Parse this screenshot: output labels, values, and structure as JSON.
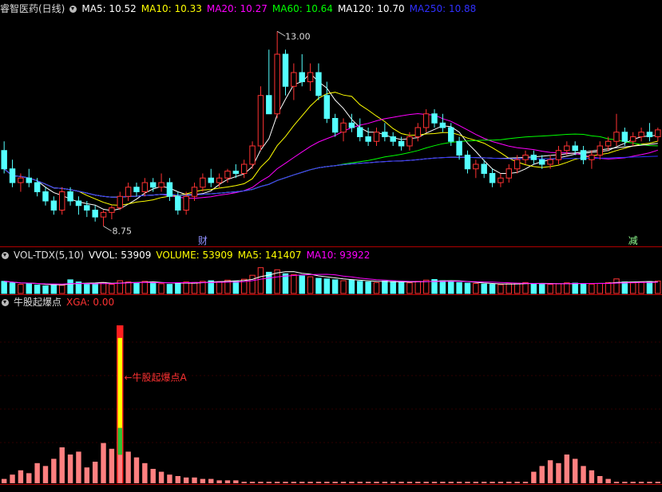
{
  "price_panel": {
    "stock_name": "睿智医药(日线)",
    "ma": [
      {
        "label": "MA5: 10.52",
        "color": "#ffffff"
      },
      {
        "label": "MA10: 10.33",
        "color": "#ffff00"
      },
      {
        "label": "MA20: 10.27",
        "color": "#ff00ff"
      },
      {
        "label": "MA60: 10.64",
        "color": "#00ff00"
      },
      {
        "label": "MA120: 10.70",
        "color": "#ffffff"
      },
      {
        "label": "MA250: 10.88",
        "color": "#3030ff"
      }
    ],
    "high_label": "13.00",
    "low_label": "8.75",
    "marker_left": "财",
    "marker_right": "减"
  },
  "volume_panel": {
    "name": "VOL-TDX(5,10)",
    "items": [
      {
        "label": "VVOL: 53909",
        "color": "#ffffff"
      },
      {
        "label": "VOLUME: 53909",
        "color": "#ffff00"
      },
      {
        "label": "MA5: 141407",
        "color": "#ffff00"
      },
      {
        "label": "MA10: 93922",
        "color": "#ff00ff"
      }
    ]
  },
  "indicator_panel": {
    "name": "牛股起爆点",
    "xga_label": "XGA: 0.00",
    "signal_label": "牛股起爆点A"
  },
  "colors": {
    "up": "#ff3232",
    "down": "#54ffff",
    "grid": "#b00000",
    "ma5": "#ffffff",
    "ma10": "#ffff00",
    "ma20": "#ff00ff",
    "ma60": "#00ff00",
    "ma120": "#ffffff",
    "ma250": "#3030ff",
    "indicator_bar": "#ff8080"
  },
  "chart_data": [
    {
      "type": "candlestick",
      "title": "睿智医药(日线)",
      "ylim": [
        8.5,
        13.3
      ],
      "ohlc": [
        [
          10.4,
          10.6,
          9.9,
          10.0
        ],
        [
          10.0,
          10.2,
          9.6,
          9.7
        ],
        [
          9.7,
          9.9,
          9.5,
          9.8
        ],
        [
          9.8,
          10.0,
          9.6,
          9.7
        ],
        [
          9.7,
          9.8,
          9.4,
          9.5
        ],
        [
          9.5,
          9.6,
          9.2,
          9.3
        ],
        [
          9.3,
          9.4,
          9.0,
          9.1
        ],
        [
          9.1,
          9.6,
          9.0,
          9.5
        ],
        [
          9.5,
          9.6,
          9.2,
          9.3
        ],
        [
          9.3,
          9.4,
          9.0,
          9.2
        ],
        [
          9.2,
          9.3,
          8.95,
          9.1
        ],
        [
          9.1,
          9.2,
          8.85,
          8.95
        ],
        [
          8.95,
          9.1,
          8.75,
          9.05
        ],
        [
          9.05,
          9.2,
          8.9,
          9.15
        ],
        [
          9.15,
          9.5,
          9.1,
          9.4
        ],
        [
          9.4,
          9.7,
          9.3,
          9.6
        ],
        [
          9.6,
          9.7,
          9.4,
          9.5
        ],
        [
          9.5,
          9.8,
          9.4,
          9.7
        ],
        [
          9.7,
          9.8,
          9.5,
          9.6
        ],
        [
          9.6,
          9.9,
          9.5,
          9.7
        ],
        [
          9.7,
          9.8,
          9.3,
          9.4
        ],
        [
          9.4,
          9.5,
          9.0,
          9.1
        ],
        [
          9.1,
          9.5,
          9.0,
          9.4
        ],
        [
          9.4,
          9.7,
          9.3,
          9.6
        ],
        [
          9.6,
          9.9,
          9.5,
          9.8
        ],
        [
          9.8,
          10.0,
          9.6,
          9.7
        ],
        [
          9.7,
          9.9,
          9.6,
          9.8
        ],
        [
          9.8,
          10.0,
          9.7,
          9.95
        ],
        [
          9.95,
          10.1,
          9.8,
          9.9
        ],
        [
          9.9,
          10.2,
          9.8,
          10.1
        ],
        [
          10.1,
          10.6,
          10.0,
          10.5
        ],
        [
          10.5,
          11.8,
          10.4,
          11.6
        ],
        [
          11.6,
          12.6,
          11.2,
          11.2
        ],
        [
          11.2,
          13.0,
          11.1,
          12.5
        ],
        [
          12.5,
          12.6,
          11.6,
          11.8
        ],
        [
          11.8,
          12.3,
          11.5,
          12.1
        ],
        [
          12.1,
          12.5,
          11.8,
          11.9
        ],
        [
          11.9,
          12.3,
          11.7,
          12.1
        ],
        [
          12.1,
          12.3,
          11.5,
          11.6
        ],
        [
          11.6,
          11.9,
          11.0,
          11.1
        ],
        [
          11.1,
          11.2,
          10.7,
          10.8
        ],
        [
          10.8,
          11.1,
          10.6,
          11.0
        ],
        [
          11.0,
          11.2,
          10.8,
          10.9
        ],
        [
          10.9,
          11.1,
          10.6,
          10.7
        ],
        [
          10.7,
          10.9,
          10.5,
          10.6
        ],
        [
          10.6,
          10.9,
          10.5,
          10.8
        ],
        [
          10.8,
          11.0,
          10.6,
          10.7
        ],
        [
          10.7,
          10.8,
          10.5,
          10.6
        ],
        [
          10.6,
          10.7,
          10.4,
          10.5
        ],
        [
          10.5,
          10.8,
          10.4,
          10.7
        ],
        [
          10.7,
          11.0,
          10.6,
          10.9
        ],
        [
          10.9,
          11.3,
          10.8,
          11.2
        ],
        [
          11.2,
          11.3,
          10.9,
          11.0
        ],
        [
          11.0,
          11.2,
          10.8,
          10.9
        ],
        [
          10.9,
          11.0,
          10.5,
          10.6
        ],
        [
          10.6,
          10.7,
          10.2,
          10.3
        ],
        [
          10.3,
          10.4,
          9.9,
          10.0
        ],
        [
          10.0,
          10.2,
          9.8,
          10.1
        ],
        [
          10.1,
          10.2,
          9.8,
          9.9
        ],
        [
          9.9,
          10.0,
          9.6,
          9.7
        ],
        [
          9.7,
          9.9,
          9.6,
          9.8
        ],
        [
          9.8,
          10.1,
          9.7,
          10.0
        ],
        [
          10.0,
          10.3,
          9.9,
          10.2
        ],
        [
          10.2,
          10.4,
          10.1,
          10.3
        ],
        [
          10.3,
          10.4,
          10.1,
          10.2
        ],
        [
          10.2,
          10.3,
          10.0,
          10.1
        ],
        [
          10.1,
          10.3,
          10.0,
          10.2
        ],
        [
          10.2,
          10.5,
          10.1,
          10.4
        ],
        [
          10.4,
          10.6,
          10.3,
          10.5
        ],
        [
          10.5,
          10.6,
          10.3,
          10.4
        ],
        [
          10.4,
          10.5,
          10.1,
          10.2
        ],
        [
          10.2,
          10.4,
          10.0,
          10.3
        ],
        [
          10.3,
          10.6,
          10.2,
          10.5
        ],
        [
          10.5,
          10.7,
          10.4,
          10.6
        ],
        [
          10.6,
          11.2,
          10.5,
          10.8
        ],
        [
          10.8,
          10.9,
          10.5,
          10.6
        ],
        [
          10.6,
          10.8,
          10.5,
          10.7
        ],
        [
          10.7,
          10.9,
          10.6,
          10.8
        ],
        [
          10.8,
          11.0,
          10.6,
          10.7
        ],
        [
          10.7,
          10.9,
          10.6,
          10.85
        ]
      ]
    },
    {
      "type": "bar",
      "title": "VOL-TDX(5,10)",
      "values": [
        40,
        35,
        30,
        32,
        28,
        25,
        30,
        27,
        45,
        38,
        30,
        33,
        36,
        30,
        42,
        38,
        35,
        40,
        37,
        32,
        30,
        34,
        38,
        36,
        40,
        42,
        39,
        44,
        41,
        47,
        60,
        85,
        70,
        78,
        65,
        62,
        58,
        55,
        50,
        48,
        45,
        42,
        44,
        40,
        38,
        36,
        41,
        39,
        37,
        35,
        40,
        44,
        46,
        42,
        39,
        36,
        34,
        33,
        31,
        30,
        29,
        32,
        34,
        36,
        33,
        31,
        30,
        32,
        35,
        34,
        33,
        31,
        33,
        36,
        48,
        38,
        35,
        37,
        39,
        41
      ],
      "ylim": [
        0,
        100
      ]
    },
    {
      "type": "bar",
      "title": "牛股起爆点",
      "values": [
        3,
        6,
        9,
        7,
        14,
        12,
        17,
        25,
        20,
        22,
        11,
        15,
        28,
        24,
        35,
        22,
        18,
        14,
        10,
        8,
        6,
        5,
        4,
        4,
        3,
        3,
        2,
        2,
        2,
        1,
        1,
        1,
        1,
        1,
        1,
        1,
        1,
        1,
        1,
        1,
        1,
        1,
        1,
        1,
        1,
        1,
        1,
        1,
        1,
        1,
        1,
        1,
        1,
        1,
        1,
        1,
        1,
        1,
        1,
        1,
        1,
        1,
        1,
        1,
        8,
        12,
        16,
        14,
        20,
        17,
        12,
        9,
        5,
        3,
        1,
        1,
        1,
        1,
        1,
        1
      ],
      "ylim": [
        0,
        120
      ],
      "signal_index": 14,
      "signal_value": 110
    }
  ]
}
